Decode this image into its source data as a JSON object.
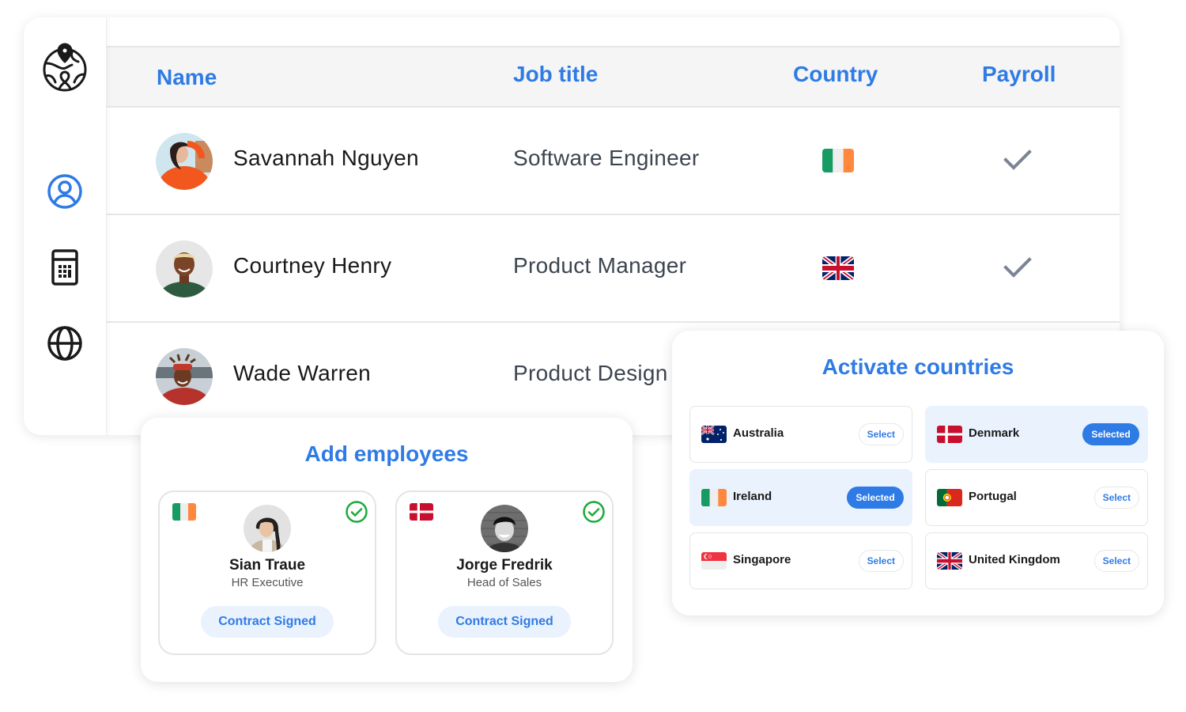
{
  "colors": {
    "accent": "#2f7be6",
    "accent_light": "#eaf2fe",
    "success": "#1aab3a",
    "check_gray": "#7a8494"
  },
  "sidebar": {
    "logo_icon": "globe-map-pin-icon",
    "items": [
      {
        "icon": "user-circle-icon",
        "active": true
      },
      {
        "icon": "calculator-icon",
        "active": false
      },
      {
        "icon": "globe-icon",
        "active": false
      }
    ]
  },
  "table": {
    "headers": [
      "Name",
      "Job title",
      "Country",
      "Payroll"
    ],
    "rows": [
      {
        "name": "Savannah Nguyen",
        "job_title": "Software Engineer",
        "country_flag": "ireland-flag-icon",
        "payroll": "check-icon"
      },
      {
        "name": "Courtney Henry",
        "job_title": "Product Manager",
        "country_flag": "uk-flag-icon",
        "payroll": "check-icon"
      },
      {
        "name": "Wade Warren",
        "job_title": "Product Design",
        "country_flag": "",
        "payroll": ""
      }
    ]
  },
  "add_employees": {
    "title": "Add employees",
    "employees": [
      {
        "name": "Sian Traue",
        "role": "HR Executive",
        "flag": "ireland-flag-icon",
        "status": "Contract Signed"
      },
      {
        "name": "Jorge Fredrik",
        "role": "Head of Sales",
        "flag": "denmark-flag-icon",
        "status": "Contract Signed"
      }
    ]
  },
  "activate_countries": {
    "title": "Activate countries",
    "countries": [
      {
        "name": "Australia",
        "button": "Select",
        "selected": false
      },
      {
        "name": "Denmark",
        "button": "Selected",
        "selected": true
      },
      {
        "name": "Ireland",
        "button": "Selected",
        "selected": true
      },
      {
        "name": "Portugal",
        "button": "Select",
        "selected": false
      },
      {
        "name": "Singapore",
        "button": "Select",
        "selected": false
      },
      {
        "name": "United Kingdom",
        "button": "Select",
        "selected": false
      }
    ]
  }
}
